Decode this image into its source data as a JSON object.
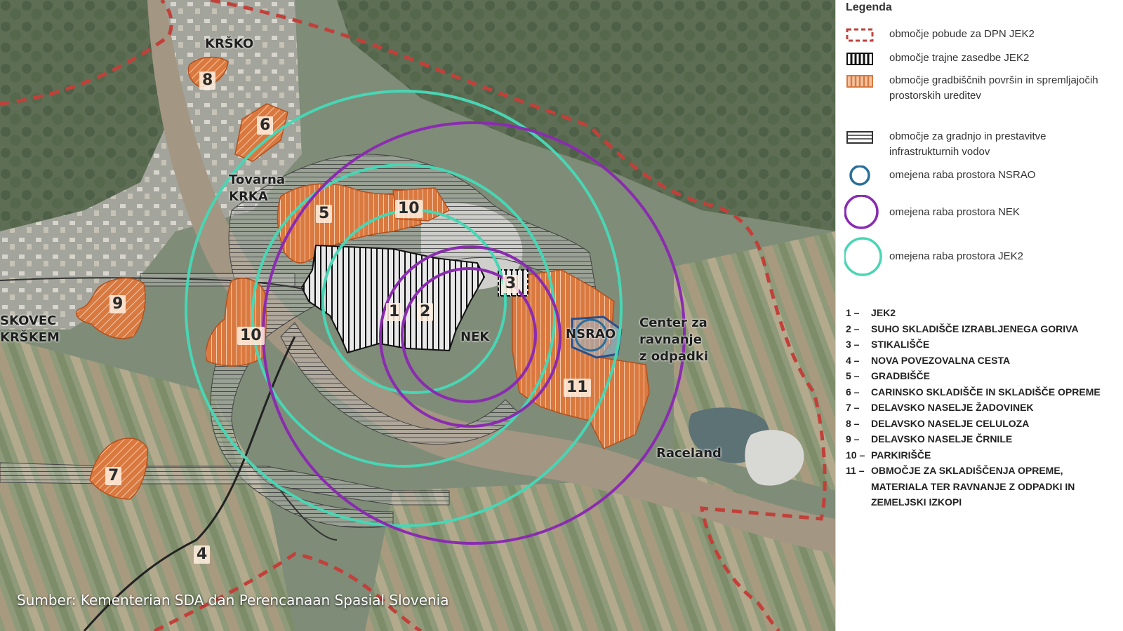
{
  "map": {
    "colors": {
      "boundary": "#c2403a",
      "nek_circle": "#8a2bb0",
      "jek2_circle": "#48d6b4",
      "nsrao_circle": "#2a6e9a",
      "construction_area": "#d9793f",
      "permanent_area": "#1a1a1a",
      "infrastructure": "#404040"
    },
    "area_numbers": {
      "krsko_8": "8",
      "area_6": "6",
      "area_5": "5",
      "area_10_top": "10",
      "area_9": "9",
      "area_10_left": "10",
      "area_1": "1",
      "area_2": "2",
      "area_3": "3",
      "area_11": "11",
      "area_7": "7",
      "area_4": "4"
    },
    "places": {
      "krsko": "KRŠKO",
      "tovarna_krka": [
        "Tovarna",
        "KRKA"
      ],
      "leskovec": [
        "SKOVEC",
        "KRŠKEM"
      ],
      "nek": "NEK",
      "nsrao": "NSRAO",
      "center": [
        "Center za",
        "ravnanje",
        "z odpadki"
      ],
      "raceland": "Raceland"
    },
    "source": "Sumber: Kementerian SDA dan Perencanaan Spasial Slovenia"
  },
  "legend": {
    "title": "Legenda",
    "items": [
      {
        "symbol": "dashed-red-rect-icon",
        "text": "območje pobude za DPN JEK2"
      },
      {
        "symbol": "black-hatch-rect-icon",
        "text": "območje trajne zasedbe JEK2"
      },
      {
        "symbol": "orange-hatch-rect-icon",
        "text": "območje gradbiščnih površin in spremljajočih prostorskih ureditev"
      },
      {
        "symbol": "gray-stripe-rect-icon",
        "text": "območje za gradnjo in prestavitve infrastrukturnih vodov"
      },
      {
        "symbol": "blue-circle-icon",
        "text": "omejena raba prostora NSRAO"
      },
      {
        "symbol": "purple-circle-icon",
        "text": "omejena raba prostora NEK"
      },
      {
        "symbol": "teal-circle-icon",
        "text": "omejena raba prostora JEK2"
      }
    ],
    "key": [
      {
        "num": "1 –",
        "text": "JEK2"
      },
      {
        "num": "2 –",
        "text": "SUHO SKLADIŠČE IZRABLJENEGA GORIVA"
      },
      {
        "num": "3 –",
        "text": "STIKALIŠČE"
      },
      {
        "num": "4 –",
        "text": "NOVA POVEZOVALNA CESTA"
      },
      {
        "num": "5 –",
        "text": "GRADBIŠČE"
      },
      {
        "num": "6 –",
        "text": "CARINSKO SKLADIŠČE IN SKLADIŠČE OPREME"
      },
      {
        "num": "7 –",
        "text": "DELAVSKO NASELJE ŽADOVINEK"
      },
      {
        "num": "8 –",
        "text": "DELAVSKO NASELJE CELULOZA"
      },
      {
        "num": "9 –",
        "text": "DELAVSKO NASELJE ČRNILE"
      },
      {
        "num": "10 –",
        "text": "PARKIRIŠČE"
      },
      {
        "num": "11 –",
        "text": "OBMOČJE ZA SKLADIŠČENJA OPREME, MATERIALA TER RAVNANJE Z ODPADKI IN ZEMELJSKI IZKOPI"
      }
    ]
  }
}
